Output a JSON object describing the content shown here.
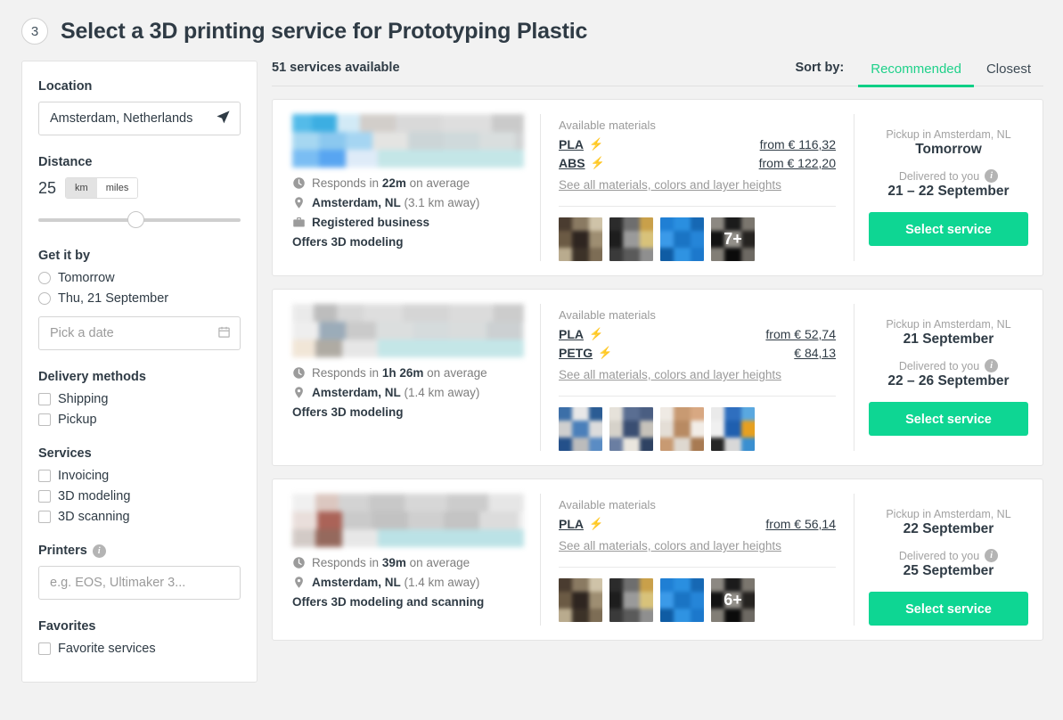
{
  "header": {
    "step": "3",
    "title": "Select a 3D printing service for Prototyping Plastic"
  },
  "sidebar": {
    "location": {
      "label": "Location",
      "value": "Amsterdam, Netherlands",
      "icon": "locate-arrow-icon"
    },
    "distance": {
      "label": "Distance",
      "value": "25",
      "units": [
        {
          "label": "km",
          "active": true
        },
        {
          "label": "miles",
          "active": false
        }
      ],
      "slider_percent": 48
    },
    "get_it_by": {
      "label": "Get it by",
      "options": [
        {
          "label": "Tomorrow",
          "checked": false
        },
        {
          "label": "Thu, 21 September",
          "checked": false
        }
      ],
      "date_placeholder": "Pick a date"
    },
    "delivery_methods": {
      "label": "Delivery methods",
      "options": [
        {
          "label": "Shipping",
          "checked": false
        },
        {
          "label": "Pickup",
          "checked": false
        }
      ]
    },
    "services": {
      "label": "Services",
      "options": [
        {
          "label": "Invoicing",
          "checked": false
        },
        {
          "label": "3D modeling",
          "checked": false
        },
        {
          "label": "3D scanning",
          "checked": false
        }
      ]
    },
    "printers": {
      "label": "Printers",
      "placeholder": "e.g. EOS, Ultimaker 3..."
    },
    "favorites": {
      "label": "Favorites",
      "options": [
        {
          "label": "Favorite services",
          "checked": false
        }
      ]
    }
  },
  "results_header": {
    "count_text": "51 services available",
    "sort_label": "Sort by:",
    "tabs": [
      {
        "label": "Recommended",
        "active": true
      },
      {
        "label": "Closest",
        "active": false
      }
    ]
  },
  "colors": {
    "accent_green": "#0ed693",
    "tab_green": "#1fd18a",
    "bolt_orange": "#f5a623",
    "page_bg": "#f2f2f2"
  },
  "cards": [
    {
      "response_time": {
        "prefix": "Responds in ",
        "value": "22m",
        "suffix": " on average"
      },
      "location": {
        "city": "Amsterdam, NL",
        "distance": "(3.1 km away)"
      },
      "registered_business": "Registered business",
      "offers": "Offers 3D modeling",
      "materials_label": "Available materials",
      "materials": [
        {
          "name": "PLA",
          "fast": true,
          "price": "from € 116,32"
        },
        {
          "name": "ABS",
          "fast": true,
          "price": "from € 122,20"
        }
      ],
      "see_all": "See all materials, colors and layer heights",
      "thumbs_more": "7+",
      "pickup_label": "Pickup in Amsterdam, NL",
      "pickup_date": "Tomorrow",
      "delivery_label": "Delivered to you",
      "delivery_date": "21 – 22 September",
      "cta": "Select service"
    },
    {
      "response_time": {
        "prefix": "Responds in ",
        "value": "1h 26m",
        "suffix": " on average"
      },
      "location": {
        "city": "Amsterdam, NL",
        "distance": "(1.4 km away)"
      },
      "registered_business": null,
      "offers": "Offers 3D modeling",
      "materials_label": "Available materials",
      "materials": [
        {
          "name": "PLA",
          "fast": true,
          "price": "from € 52,74"
        },
        {
          "name": "PETG",
          "fast": true,
          "price": "€ 84,13"
        }
      ],
      "see_all": "See all materials, colors and layer heights",
      "thumbs_more": null,
      "pickup_label": "Pickup in Amsterdam, NL",
      "pickup_date": "21 September",
      "delivery_label": "Delivered to you",
      "delivery_date": "22 – 26 September",
      "cta": "Select service"
    },
    {
      "response_time": {
        "prefix": "Responds in ",
        "value": "39m",
        "suffix": " on average"
      },
      "location": {
        "city": "Amsterdam, NL",
        "distance": "(1.4 km away)"
      },
      "registered_business": null,
      "offers": "Offers 3D modeling and scanning",
      "materials_label": "Available materials",
      "materials": [
        {
          "name": "PLA",
          "fast": true,
          "price": "from € 56,14"
        }
      ],
      "see_all": "See all materials, colors and layer heights",
      "thumbs_more": "6+",
      "pickup_label": "Pickup in Amsterdam, NL",
      "pickup_date": "22 September",
      "delivery_label": "Delivered to you",
      "delivery_date": "25 September",
      "cta": "Select service"
    }
  ]
}
